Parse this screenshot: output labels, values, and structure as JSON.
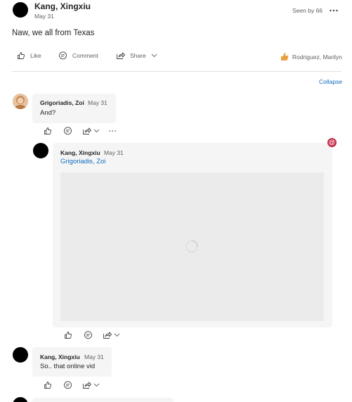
{
  "post": {
    "author": "Kang, Xingxiu",
    "date": "May 31",
    "seen_by": "Seen by 66",
    "body": "Naw, we all from Texas",
    "actions": {
      "like": "Like",
      "comment": "Comment",
      "share": "Share"
    },
    "reactors": "Rodriguez, Marilyn",
    "collapse": "Collapse"
  },
  "replies": [
    {
      "author": "Grigoriadis, Zoi",
      "date": "May 31",
      "text": "And?"
    },
    {
      "author": "Kang, Xingxiu",
      "date": "May 31",
      "mention": "Grigoriadis, Zoi"
    },
    {
      "author": "Kang, Xingxiu",
      "date": "May 31",
      "text": "So.. that online vid"
    }
  ],
  "icons": {
    "more": "more-icon",
    "like": "thumb-up-icon",
    "comment": "comment-icon",
    "share": "share-icon",
    "chevron": "chevron-down-icon",
    "mention": "mention-badge-icon",
    "loading": "loading-spinner-icon"
  },
  "colors": {
    "link": "#0f6cbd",
    "mention_badge": "#c4314b",
    "reaction": "#e8a23d"
  }
}
